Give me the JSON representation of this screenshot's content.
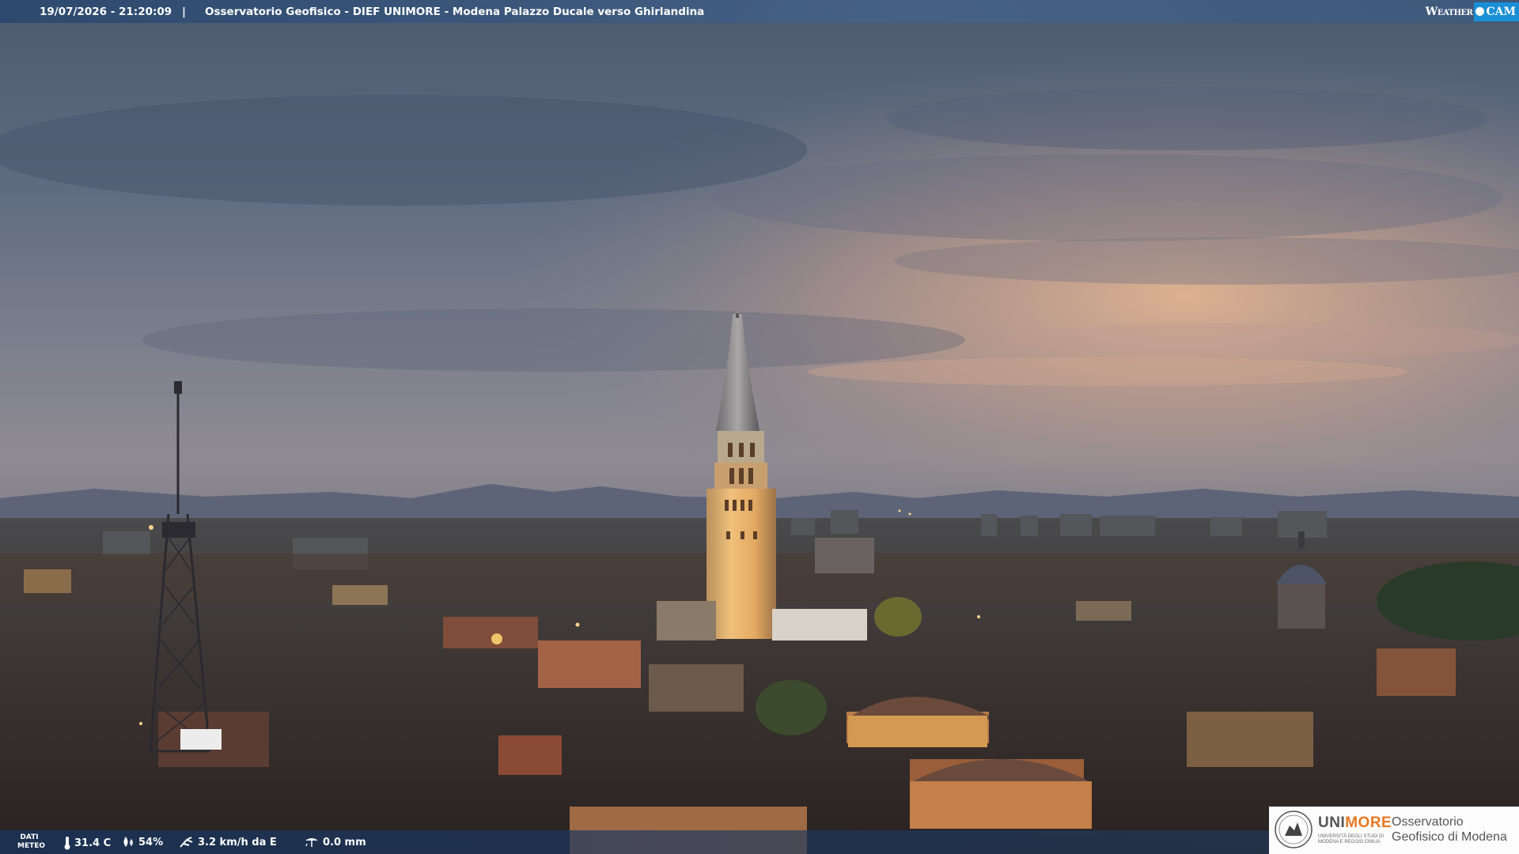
{
  "header": {
    "timestamp": "19/07/2026 - 21:20:09",
    "separator": "|",
    "camera_title": "Osservatorio Geofisico - DIEF UNIMORE - Modena Palazzo Ducale verso Ghirlandina",
    "brand_left": "Weather",
    "brand_right": "CAM"
  },
  "weather": {
    "label": "DATI METEO",
    "temperature": "31.4 C",
    "humidity": "54%",
    "wind": "3.2 km/h da E",
    "rain": "0.0 mm"
  },
  "logo": {
    "uni_a": "UNI",
    "uni_b": "MORE",
    "university": "UNIVERSITÀ DEGLI STUDI DI MODENA E REGGIO EMILIA",
    "observatory": "Osservatorio Geofisico di Modena"
  },
  "colors": {
    "header_bar": "#36567f",
    "brand_blue": "#1a8fd6",
    "unimore_orange": "#e87722",
    "sky_top": "#4f5e74",
    "sunset_glow": "#e9b58f"
  },
  "icons": {
    "temperature": "thermometer-icon",
    "humidity": "droplet-icon",
    "wind": "wind-icon",
    "rain": "rain-gauge-icon"
  }
}
